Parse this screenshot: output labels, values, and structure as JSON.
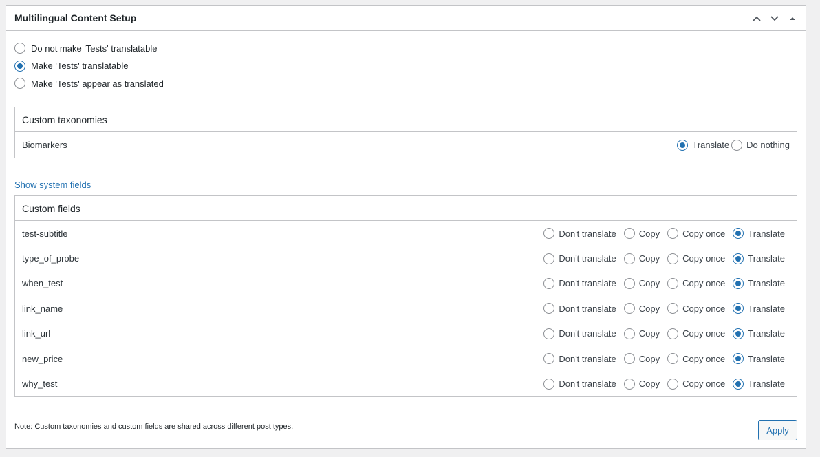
{
  "metabox": {
    "title": "Multilingual Content Setup"
  },
  "mode_options": [
    {
      "label": "Do not make 'Tests' translatable",
      "checked": false
    },
    {
      "label": "Make 'Tests' translatable",
      "checked": true
    },
    {
      "label": "Make 'Tests' appear as translated",
      "checked": false
    }
  ],
  "taxonomies": {
    "heading": "Custom taxonomies",
    "rows": [
      {
        "name": "Biomarkers",
        "options": [
          {
            "label": "Translate",
            "checked": true
          },
          {
            "label": "Do nothing",
            "checked": false
          }
        ]
      }
    ]
  },
  "show_system_fields_link": "Show system fields",
  "custom_fields": {
    "heading": "Custom fields",
    "option_labels": [
      "Don't translate",
      "Copy",
      "Copy once",
      "Translate"
    ],
    "rows": [
      {
        "name": "test-subtitle",
        "selected": "Translate"
      },
      {
        "name": "type_of_probe",
        "selected": "Translate"
      },
      {
        "name": "when_test",
        "selected": "Translate"
      },
      {
        "name": "link_name",
        "selected": "Translate"
      },
      {
        "name": "link_url",
        "selected": "Translate"
      },
      {
        "name": "new_price",
        "selected": "Translate"
      },
      {
        "name": "why_test",
        "selected": "Translate"
      }
    ]
  },
  "note": "Note: Custom taxonomies and custom fields are shared across different post types.",
  "apply_label": "Apply",
  "colors": {
    "accent": "#2271b1",
    "border": "#c3c4c7",
    "background": "#f0f0f1"
  }
}
